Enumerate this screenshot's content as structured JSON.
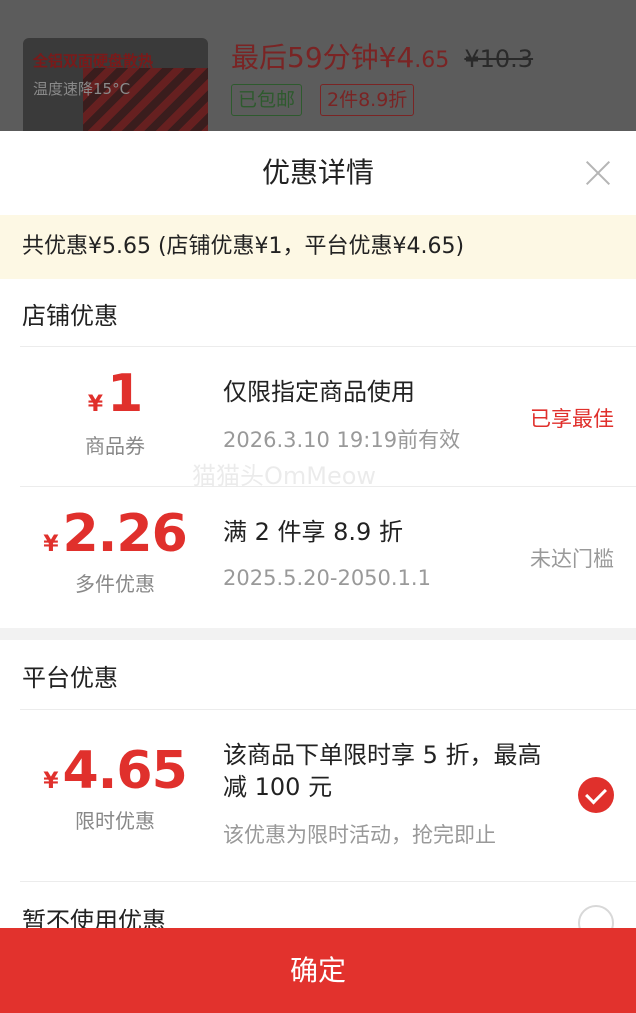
{
  "product": {
    "thumb_line1": "全铝双面硬盘散热",
    "thumb_line2": "温度速降15°C",
    "price_prefix": "最后59分钟¥4",
    "price_cents": ".65",
    "original_price": "¥10.3",
    "tag_free_shipping": "已包邮",
    "tag_multi": "2件8.9折"
  },
  "sheet": {
    "title": "优惠详情",
    "summary": "共优惠¥5.65 (店铺优惠¥1，平台优惠¥4.65)"
  },
  "store_section": {
    "title": "店铺优惠",
    "coupons": [
      {
        "currency": "¥",
        "amount": "1",
        "label": "商品券",
        "title": "仅限指定商品使用",
        "sub": "2026.3.10 19:19前有效",
        "status": "已享最佳"
      },
      {
        "currency": "¥",
        "amount": "2.26",
        "label": "多件优惠",
        "title": "满 2 件享 8.9 折",
        "sub": "2025.5.20-2050.1.1",
        "status": "未达门槛"
      }
    ]
  },
  "platform_section": {
    "title": "平台优惠",
    "coupon": {
      "currency": "¥",
      "amount": "4.65",
      "label": "限时优惠",
      "title_line1": "该商品下单限时享 5 折，最高",
      "title_line2": "减 100 元",
      "sub": "该优惠为限时活动，抢完即止",
      "selected": true
    },
    "no_discount_label": "暂不使用优惠"
  },
  "watermark": "猫猫头OmMeow",
  "confirm_label": "确定",
  "colors": {
    "accent": "#e0302c",
    "summary_bg": "#fdf8e4",
    "overlay": "#4a4a4a"
  }
}
